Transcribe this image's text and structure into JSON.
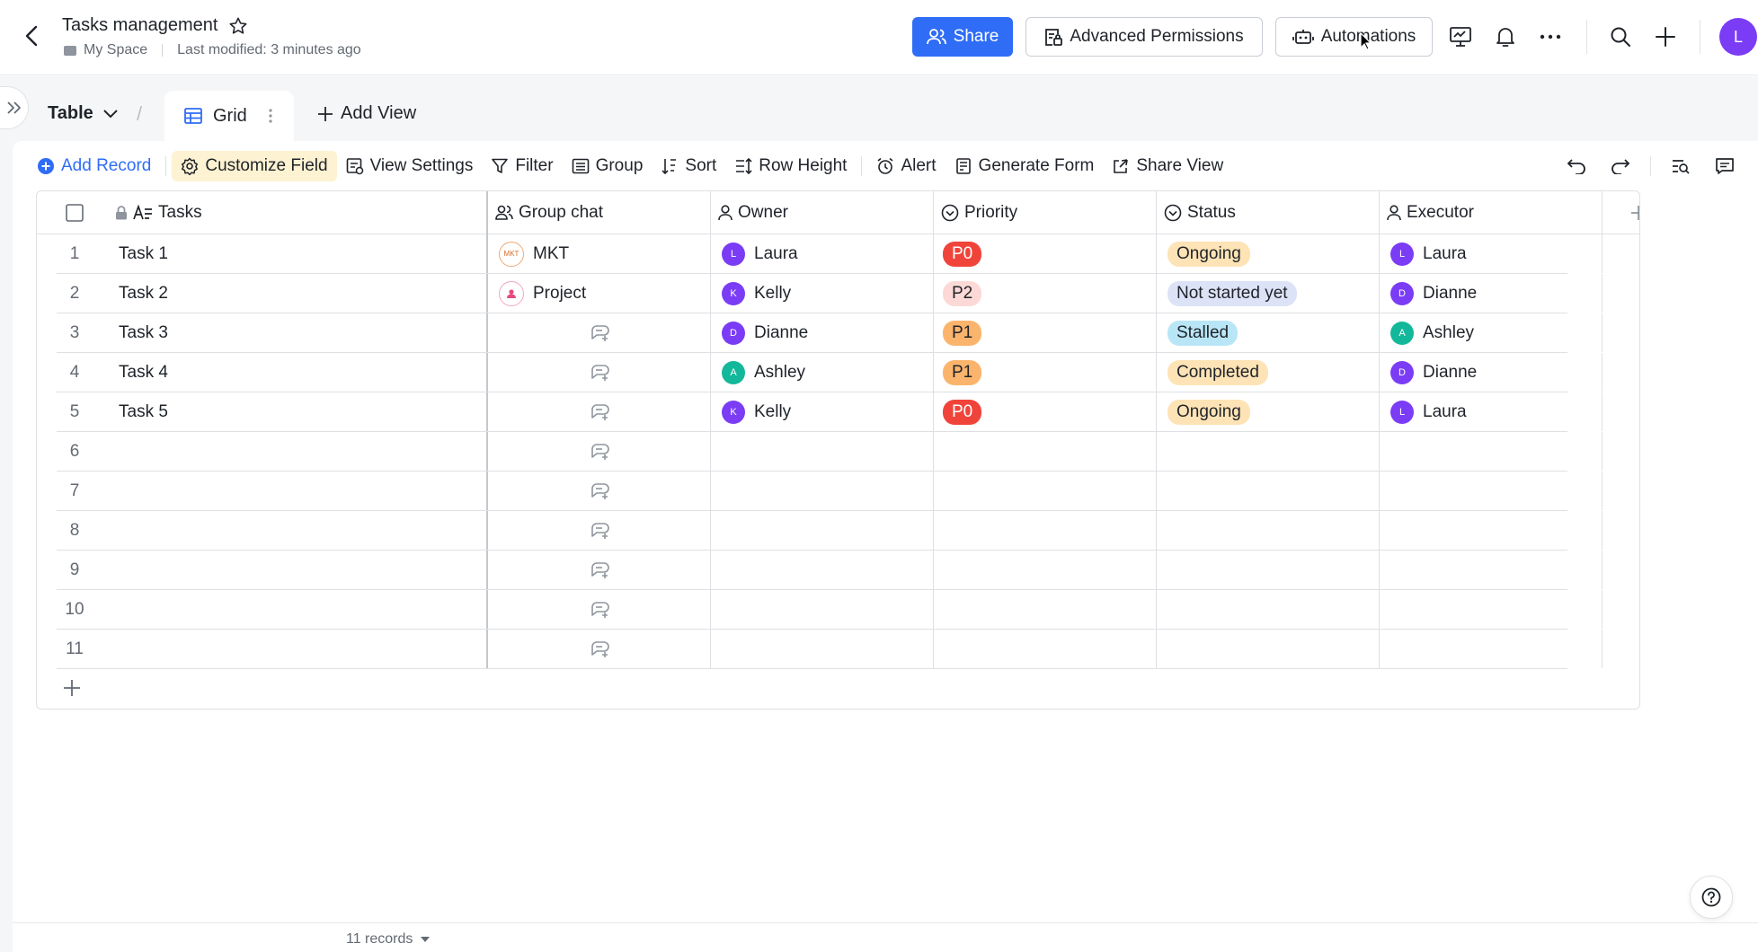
{
  "header": {
    "title": "Tasks management",
    "location": "My Space",
    "modified": "Last modified: 3 minutes ago",
    "share_label": "Share",
    "permissions_label": "Advanced Permissions",
    "automations_label": "Automations",
    "avatar_initial": "L"
  },
  "views": {
    "table_label": "Table",
    "slash": "/",
    "active_tab": "Grid",
    "add_view_label": "Add View"
  },
  "toolbar": {
    "add_record": "Add Record",
    "customize_field": "Customize Field",
    "view_settings": "View Settings",
    "filter": "Filter",
    "group": "Group",
    "sort": "Sort",
    "row_height": "Row Height",
    "alert": "Alert",
    "generate_form": "Generate Form",
    "share_view": "Share View"
  },
  "columns": {
    "tasks": "Tasks",
    "group_chat": "Group chat",
    "owner": "Owner",
    "priority": "Priority",
    "status": "Status",
    "executor": "Executor"
  },
  "rows": [
    {
      "num": "1",
      "task": "Task 1",
      "chat": "MKT",
      "chat_icon": "MKT",
      "owner": "Laura",
      "owner_initial": "L",
      "owner_color": "#7b3cf5",
      "priority": "P0",
      "priority_bg": "#f0443b",
      "priority_fg": "#ffffff",
      "status": "Ongoing",
      "status_bg": "#fde3b5",
      "executor": "Laura",
      "executor_initial": "L",
      "executor_color": "#7b3cf5"
    },
    {
      "num": "2",
      "task": "Task 2",
      "chat": "Project",
      "chat_icon": "people-icon",
      "owner": "Kelly",
      "owner_initial": "K",
      "owner_color": "#7b3cf5",
      "priority": "P2",
      "priority_bg": "#fcd9d6",
      "priority_fg": "#1f2329",
      "status": "Not started yet",
      "status_bg": "#dde3f7",
      "executor": "Dianne",
      "executor_initial": "D",
      "executor_color": "#7b3cf5"
    },
    {
      "num": "3",
      "task": "Task 3",
      "chat": "",
      "owner": "Dianne",
      "owner_initial": "D",
      "owner_color": "#7b3cf5",
      "priority": "P1",
      "priority_bg": "#fbb46c",
      "priority_fg": "#1f2329",
      "status": "Stalled",
      "status_bg": "#b9e6f7",
      "executor": "Ashley",
      "executor_initial": "A",
      "executor_color": "#13b89a"
    },
    {
      "num": "4",
      "task": "Task 4",
      "chat": "",
      "owner": "Ashley",
      "owner_initial": "A",
      "owner_color": "#13b89a",
      "priority": "P1",
      "priority_bg": "#fbb46c",
      "priority_fg": "#1f2329",
      "status": "Completed",
      "status_bg": "#fde3b5",
      "executor": "Dianne",
      "executor_initial": "D",
      "executor_color": "#7b3cf5"
    },
    {
      "num": "5",
      "task": "Task 5",
      "chat": "",
      "owner": "Kelly",
      "owner_initial": "K",
      "owner_color": "#7b3cf5",
      "priority": "P0",
      "priority_bg": "#f0443b",
      "priority_fg": "#ffffff",
      "status": "Ongoing",
      "status_bg": "#fde3b5",
      "executor": "Laura",
      "executor_initial": "L",
      "executor_color": "#7b3cf5"
    },
    {
      "num": "6",
      "task": "",
      "chat": "",
      "owner": "",
      "priority": "",
      "status": "",
      "executor": ""
    },
    {
      "num": "7",
      "task": "",
      "chat": "",
      "owner": "",
      "priority": "",
      "status": "",
      "executor": ""
    },
    {
      "num": "8",
      "task": "",
      "chat": "",
      "owner": "",
      "priority": "",
      "status": "",
      "executor": ""
    },
    {
      "num": "9",
      "task": "",
      "chat": "",
      "owner": "",
      "priority": "",
      "status": "",
      "executor": ""
    },
    {
      "num": "10",
      "task": "",
      "chat": "",
      "owner": "",
      "priority": "",
      "status": "",
      "executor": ""
    },
    {
      "num": "11",
      "task": "",
      "chat": "",
      "owner": "",
      "priority": "",
      "status": "",
      "executor": ""
    }
  ],
  "footer": {
    "records": "11 records"
  },
  "colors": {
    "accent": "#2f6df6",
    "avatar_purple": "#7b3cf5",
    "avatar_green": "#13b89a"
  }
}
